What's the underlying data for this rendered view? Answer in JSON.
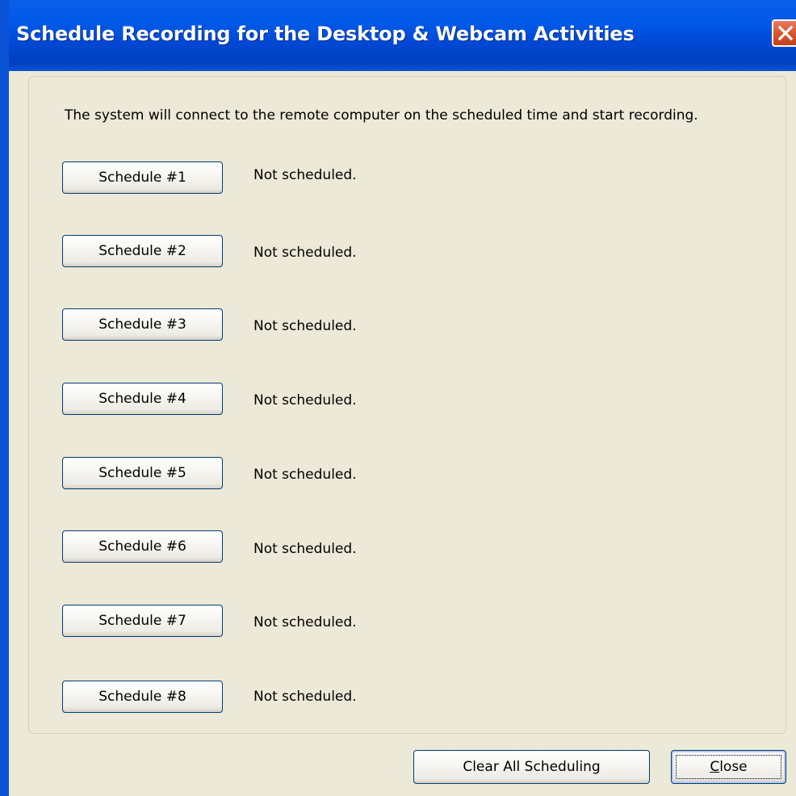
{
  "window": {
    "title": "Schedule Recording for the Desktop & Webcam Activities",
    "close_icon": "close-x-icon"
  },
  "intro_text": "The system will connect to the remote computer on the scheduled time and start recording.",
  "schedules": [
    {
      "label": "Schedule #1",
      "status": "Not scheduled."
    },
    {
      "label": "Schedule #2",
      "status": "Not scheduled."
    },
    {
      "label": "Schedule #3",
      "status": "Not scheduled."
    },
    {
      "label": "Schedule #4",
      "status": "Not scheduled."
    },
    {
      "label": "Schedule #5",
      "status": "Not scheduled."
    },
    {
      "label": "Schedule #6",
      "status": "Not scheduled."
    },
    {
      "label": "Schedule #7",
      "status": "Not scheduled."
    },
    {
      "label": "Schedule #8",
      "status": "Not scheduled."
    }
  ],
  "footer": {
    "clear_label": "Clear All Scheduling",
    "close_label_mnemonic": "C",
    "close_label_rest": "lose"
  },
  "colors": {
    "titlebar": "#0058E6",
    "dialog_bg": "#ECE9D8",
    "button_border": "#003C74",
    "close_button": "#D8572F"
  }
}
